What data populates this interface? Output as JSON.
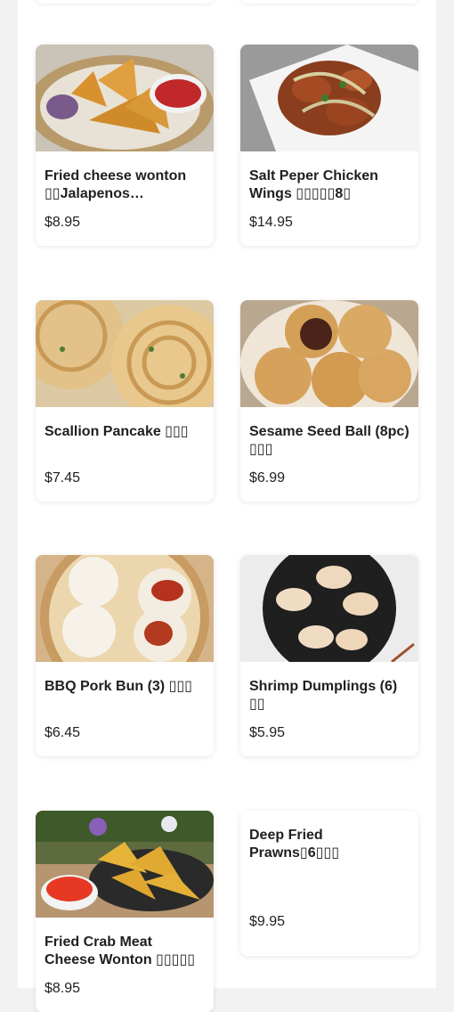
{
  "items": [
    {
      "name": "Fried cheese wonton ▯▯Jalapenos Artichoke...",
      "price": "$8.95",
      "image": "fried-wonton-basket-image"
    },
    {
      "name": "Salt Peper Chicken Wings ▯▯▯▯▯8▯",
      "price": "$14.95",
      "image": "chicken-wings-plate-image"
    },
    {
      "name": "Scallion Pancake ▯▯▯",
      "price": "$7.45",
      "image": "scallion-pancake-image"
    },
    {
      "name": "Sesame Seed Ball (8pc) ▯▯▯",
      "price": "$6.99",
      "image": "sesame-balls-image"
    },
    {
      "name": "BBQ Pork Bun (3) ▯▯▯",
      "price": "$6.45",
      "image": "pork-bun-steamer-image"
    },
    {
      "name": "Shrimp Dumplings (6) ▯▯",
      "price": "$5.95",
      "image": "shrimp-dumplings-plate-image"
    },
    {
      "name": "Fried Crab Meat Cheese Wonton ▯▯▯▯▯",
      "price": "$8.95",
      "image": "crab-wonton-tray-image"
    },
    {
      "name": "Deep Fried Prawns▯6▯▯▯",
      "price": "$9.95",
      "image": ""
    }
  ]
}
